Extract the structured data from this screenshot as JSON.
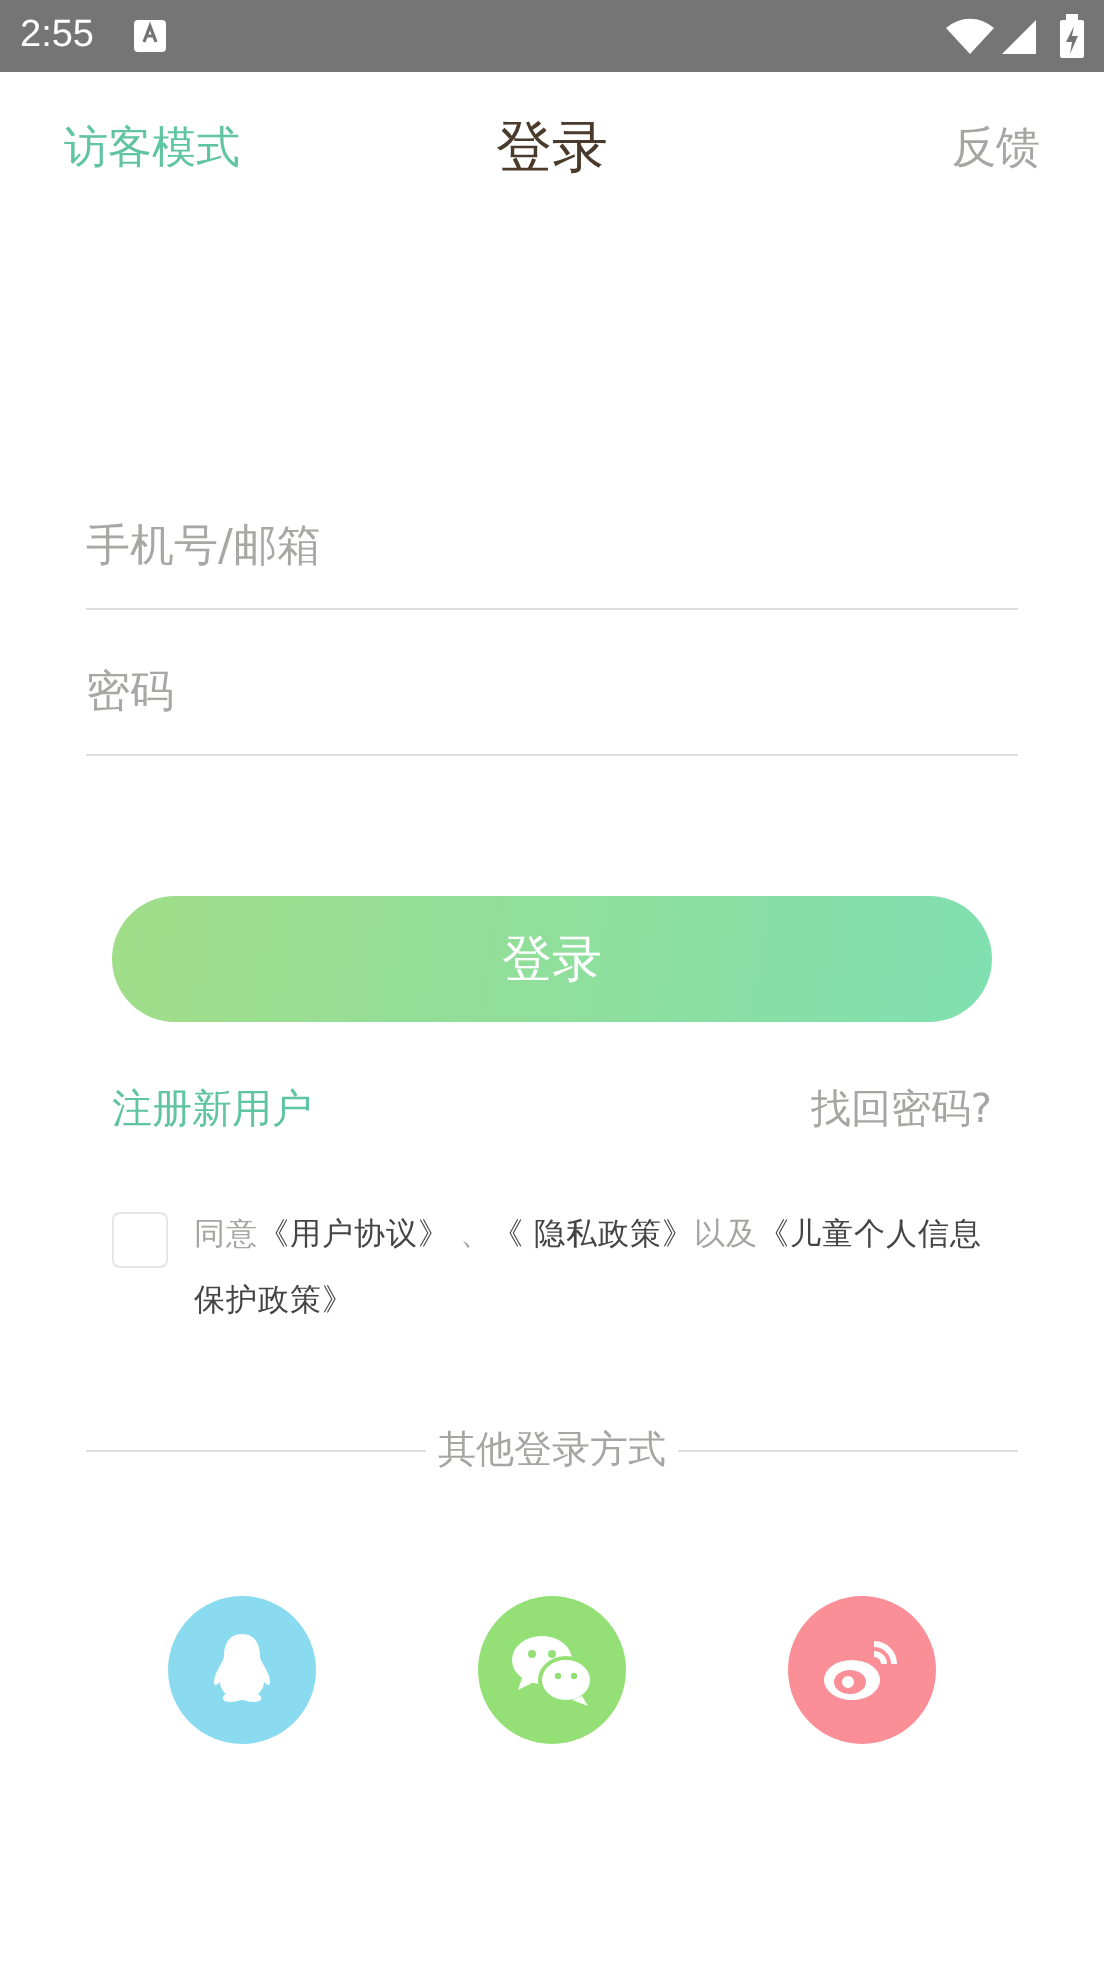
{
  "status_bar": {
    "time": "2:55"
  },
  "header": {
    "guest_mode": "访客模式",
    "title": "登录",
    "feedback": "反馈"
  },
  "fields": [
    {
      "placeholder": "手机号/邮箱"
    },
    {
      "placeholder": "密码"
    }
  ],
  "login_button": "登录",
  "links": {
    "register": "注册新用户",
    "recover": "找回密码?"
  },
  "agreement": {
    "checked": false,
    "parts": [
      {
        "kind": "plain",
        "text": "同意"
      },
      {
        "kind": "link",
        "text": "《用户协议》"
      },
      {
        "kind": "plain",
        "text": " 、"
      },
      {
        "kind": "link",
        "text": "《 隐私政策》"
      },
      {
        "kind": "plain",
        "text": "以及"
      },
      {
        "kind": "link",
        "text": "《儿童个人信息保护政策》"
      }
    ]
  },
  "other_login": {
    "title": "其他登录方式",
    "methods": [
      {
        "kind": "penguin",
        "color": "#8adbf0"
      },
      {
        "kind": "chat",
        "color": "#94e077"
      },
      {
        "kind": "eye",
        "color": "#fb8f98"
      }
    ]
  }
}
